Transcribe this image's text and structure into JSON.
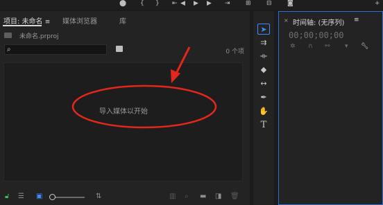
{
  "topbar": {
    "icons": [
      "marker-icon",
      "in-point-icon",
      "out-point-icon",
      "go-to-in-icon",
      "step-back-icon",
      "play-icon",
      "step-forward-icon",
      "go-to-out-icon",
      "insert-icon",
      "overwrite-icon",
      "export-frame-icon",
      "add-button-icon"
    ]
  },
  "project_panel": {
    "tabs": [
      {
        "label": "项目: 未命名",
        "active": true
      },
      {
        "label": "媒体浏览器",
        "active": false
      },
      {
        "label": "库",
        "active": false
      }
    ],
    "tab_menu_glyph": "≡",
    "file_name": "未命名.prproj",
    "search": {
      "value": "",
      "placeholder": ""
    },
    "item_count": "0 个项",
    "import_hint": "导入媒体以开始",
    "bottom_icons": [
      "lock-icon",
      "list-view-icon",
      "icon-view-icon",
      "zoom-slider-icon",
      "sort-icon",
      "automate-to-sequence-icon",
      "find-icon",
      "new-bin-icon",
      "new-item-icon",
      "clear-icon"
    ]
  },
  "tools": {
    "items": [
      "selection-tool",
      "track-select-tool",
      "ripple-edit-tool",
      "razor-tool",
      "slip-tool",
      "pen-tool",
      "hand-tool",
      "type-tool"
    ],
    "active": "selection-tool"
  },
  "timeline_panel": {
    "close_glyph": "×",
    "title": "时间轴: (无序列)",
    "menu_glyph": "≡",
    "timecode": "00;00;00;00",
    "icons": [
      "nest-icon",
      "snap-icon",
      "linked-selection-icon",
      "add-marker-icon",
      "settings-wrench-icon"
    ]
  },
  "colors": {
    "accent": "#3d8bff",
    "annotation": "#e5271b",
    "panel_bg": "#232323"
  }
}
